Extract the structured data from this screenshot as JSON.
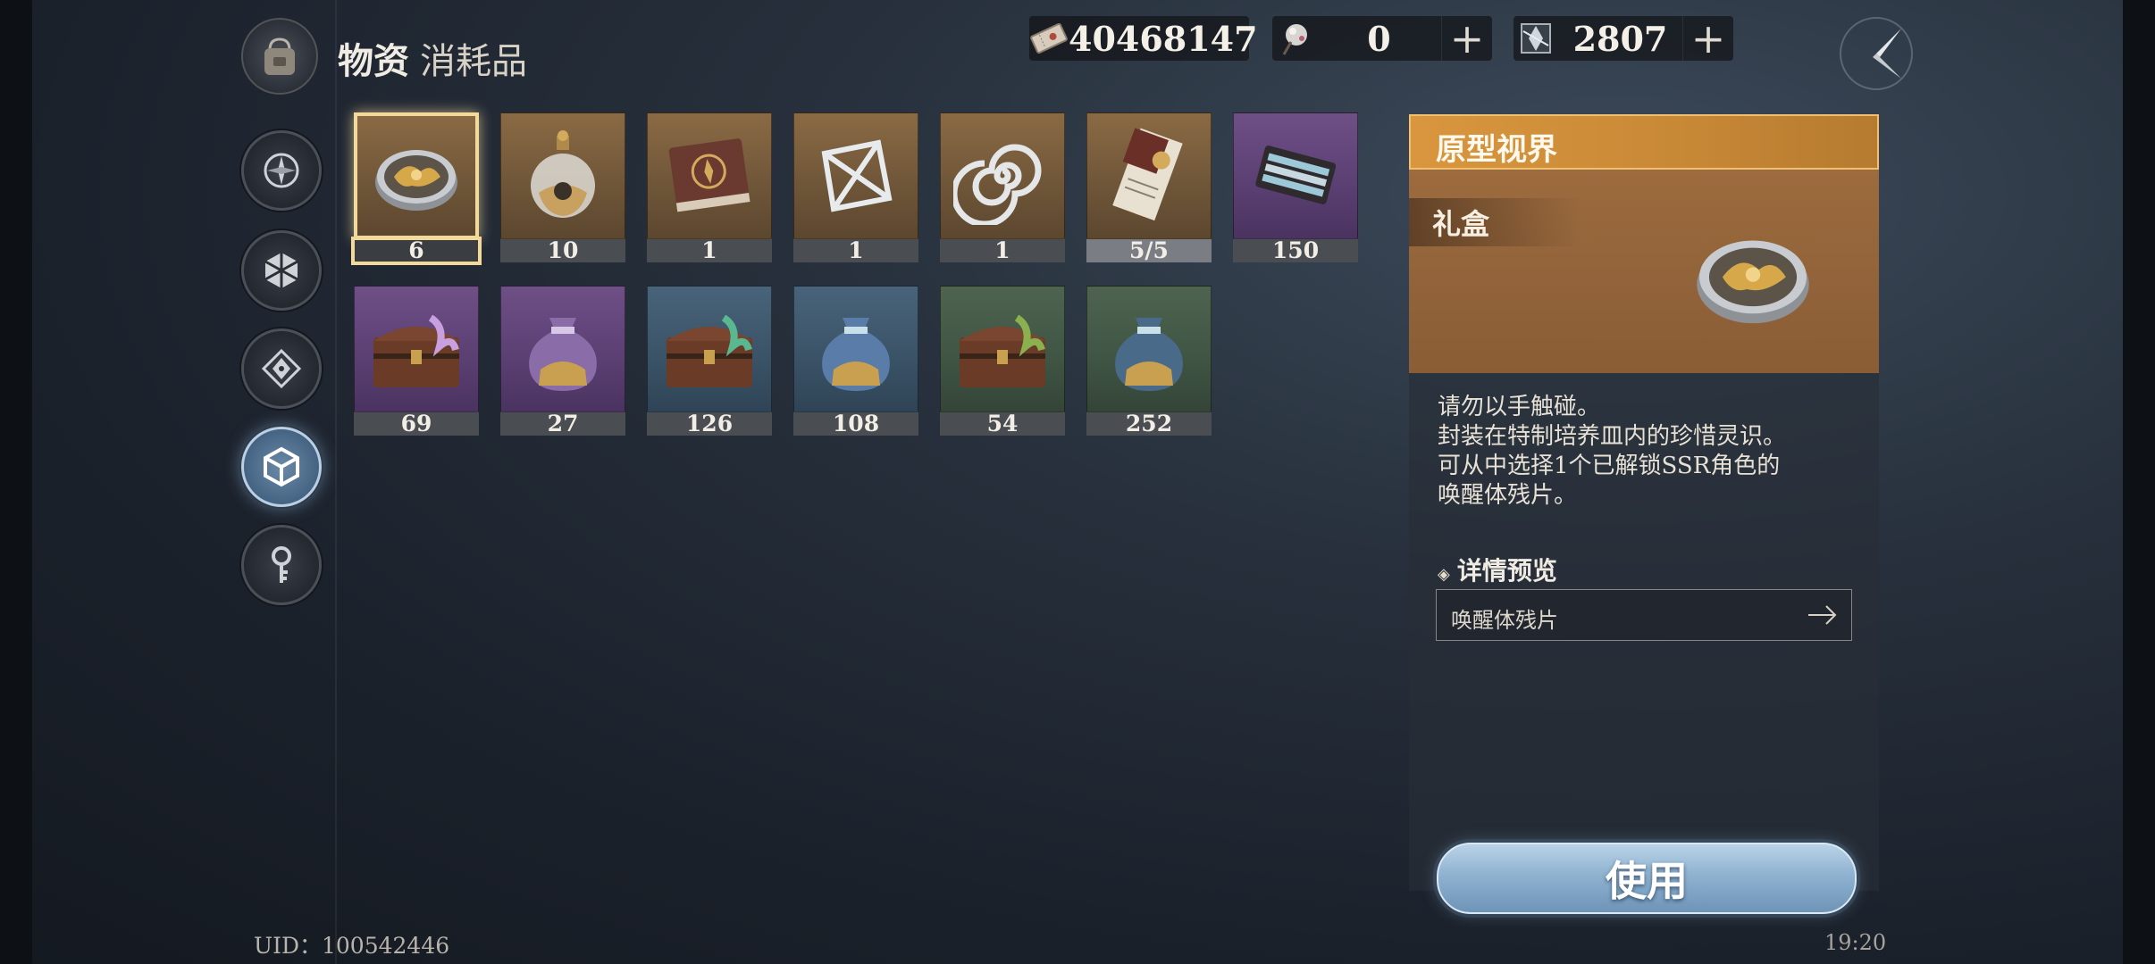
{
  "header": {
    "title": "物资",
    "subtitle": "消耗品"
  },
  "currencies": [
    {
      "icon": "ticket-icon",
      "value": "40468147"
    },
    {
      "icon": "orb-icon",
      "value": "0"
    },
    {
      "icon": "crystal-icon",
      "value": "2807"
    }
  ],
  "plus_label": "+",
  "sidebar": {
    "items": [
      {
        "name": "compass",
        "active": false
      },
      {
        "name": "hexagon",
        "active": false
      },
      {
        "name": "diamond",
        "active": false
      },
      {
        "name": "cube",
        "active": true
      },
      {
        "name": "key",
        "active": false
      }
    ]
  },
  "items": [
    {
      "count": "6",
      "rarity": "gold",
      "icon": "petri-dish-icon",
      "selected": true
    },
    {
      "count": "10",
      "rarity": "gold",
      "icon": "potion-flask-icon"
    },
    {
      "count": "1",
      "rarity": "gold",
      "icon": "book-icon"
    },
    {
      "count": "1",
      "rarity": "gold",
      "icon": "wireframe-cube-icon"
    },
    {
      "count": "1",
      "rarity": "gold",
      "icon": "spiral-icon"
    },
    {
      "count": "5/5",
      "rarity": "gold",
      "icon": "letter-icon"
    },
    {
      "count": "150",
      "rarity": "purple",
      "icon": "tool-kit-icon"
    },
    {
      "count": "69",
      "rarity": "purple",
      "icon": "chest-icon"
    },
    {
      "count": "27",
      "rarity": "purple",
      "icon": "pouch-icon"
    },
    {
      "count": "126",
      "rarity": "blue",
      "icon": "chest-icon"
    },
    {
      "count": "108",
      "rarity": "blue",
      "icon": "pouch-icon"
    },
    {
      "count": "54",
      "rarity": "green",
      "icon": "chest-icon"
    },
    {
      "count": "252",
      "rarity": "green",
      "icon": "pouch-icon"
    }
  ],
  "detail": {
    "name": "原型视界",
    "type": "礼盒",
    "description": [
      "请勿以手触碰。",
      "封装在特制培养皿内的珍惜灵识。",
      "可从中选择1个已解锁SSR角色的",
      "唤醒体残片。"
    ],
    "preview_title": "详情预览",
    "preview_item": "唤醒体残片",
    "use_label": "使用"
  },
  "footer": {
    "uid": "UID：100542446",
    "time": "19:20"
  },
  "colors": {
    "gold": "#c89a52",
    "purple": "#b682d6",
    "blue": "#88a8c6",
    "green": "#8aa68a",
    "accent_header": "#d9963e",
    "use_button": "#8fb2d0"
  }
}
